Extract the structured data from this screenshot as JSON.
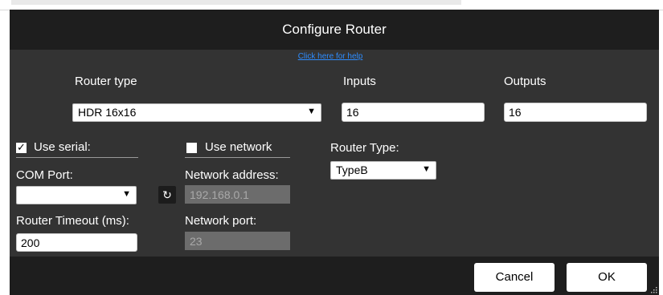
{
  "dialog": {
    "title": "Configure Router",
    "help_link": "Click here for help"
  },
  "router": {
    "type_label": "Router type",
    "type_value": "HDR 16x16",
    "inputs_label": "Inputs",
    "inputs_value": "16",
    "outputs_label": "Outputs",
    "outputs_value": "16"
  },
  "serial": {
    "checkbox_label": "Use serial:",
    "checked": true,
    "com_port_label": "COM Port:",
    "com_port_value": "",
    "timeout_label": "Router Timeout (ms):",
    "timeout_value": "200"
  },
  "network": {
    "checkbox_label": "Use network",
    "checked": false,
    "address_label": "Network address:",
    "address_value": "192.168.0.1",
    "port_label": "Network port:",
    "port_value": "23"
  },
  "router_type2": {
    "label": "Router Type:",
    "value": "TypeB"
  },
  "buttons": {
    "cancel": "Cancel",
    "ok": "OK"
  },
  "icons": {
    "dropdown": "caret-down-icon",
    "refresh": "refresh-icon",
    "checkbox_checked": "check-icon",
    "resize": "resize-grip-icon"
  },
  "colors": {
    "dialog_bg": "#333333",
    "titlebar_bg": "#1e1e1e",
    "link": "#2d8cff",
    "disabled_field": "#6c6c6c"
  }
}
